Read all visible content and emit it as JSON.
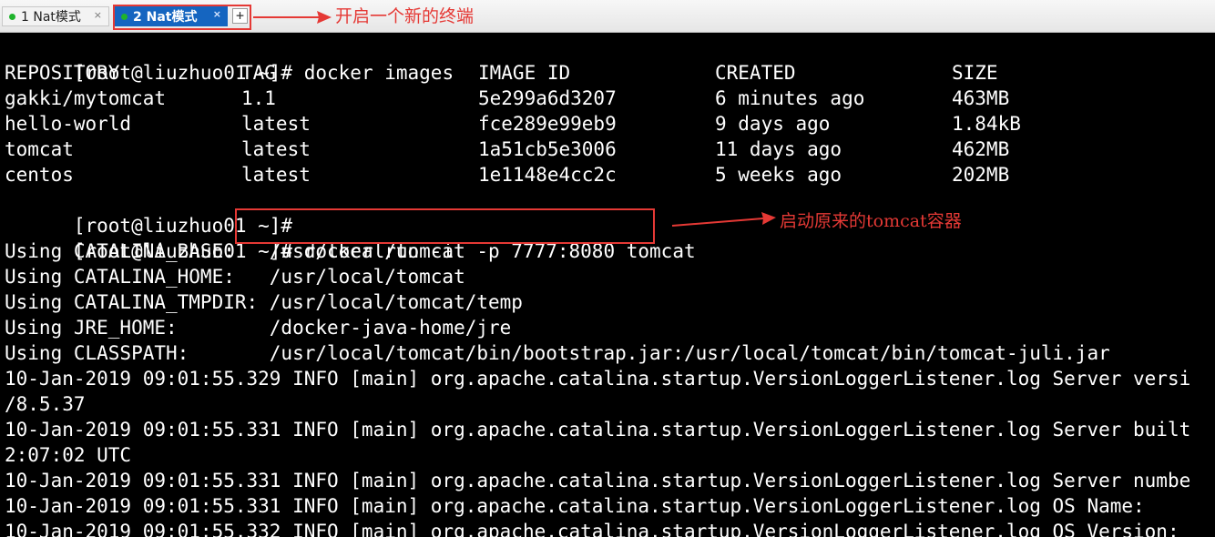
{
  "tabs": [
    {
      "label": "1 Nat模式",
      "close": "×",
      "active": false
    },
    {
      "label": "2 Nat模式",
      "close": "×",
      "active": true
    }
  ],
  "new_tab_label": "+",
  "annotations": {
    "new_terminal": "开启一个新的终端",
    "start_container": "启动原来的tomcat容器"
  },
  "colors": {
    "annotation_red": "#e53935",
    "active_tab": "#1565c0",
    "status_dot": "#1fb32b",
    "terminal_bg": "#000000",
    "terminal_fg": "#ffffff"
  },
  "terminal": {
    "prompt": "[root@liuzhuo01 ~]#",
    "cmd_images": "docker images",
    "images_table": {
      "headers": [
        "REPOSITORY",
        "TAG",
        "IMAGE ID",
        "CREATED",
        "SIZE"
      ],
      "rows": [
        [
          "gakki/mytomcat",
          "1.1",
          "5e299a6d3207",
          "6 minutes ago",
          "463MB"
        ],
        [
          "hello-world",
          "latest",
          "fce289e99eb9",
          "9 days ago",
          "1.84kB"
        ],
        [
          "tomcat",
          "latest",
          "1a51cb5e3006",
          "11 days ago",
          "462MB"
        ],
        [
          "centos",
          "latest",
          "1e1148e4cc2c",
          "5 weeks ago",
          "202MB"
        ]
      ]
    },
    "cmd_run": "docker run -it -p 7777:8080 tomcat",
    "env_lines": [
      "Using CATALINA_BASE:   /usr/local/tomcat",
      "Using CATALINA_HOME:   /usr/local/tomcat",
      "Using CATALINA_TMPDIR: /usr/local/tomcat/temp",
      "Using JRE_HOME:        /docker-java-home/jre",
      "Using CLASSPATH:       /usr/local/tomcat/bin/bootstrap.jar:/usr/local/tomcat/bin/tomcat-juli.jar"
    ],
    "log_lines": [
      "10-Jan-2019 09:01:55.329 INFO [main] org.apache.catalina.startup.VersionLoggerListener.log Server versi",
      "/8.5.37",
      "10-Jan-2019 09:01:55.331 INFO [main] org.apache.catalina.startup.VersionLoggerListener.log Server built",
      "2:07:02 UTC",
      "10-Jan-2019 09:01:55.331 INFO [main] org.apache.catalina.startup.VersionLoggerListener.log Server numbe",
      "10-Jan-2019 09:01:55.331 INFO [main] org.apache.catalina.startup.VersionLoggerListener.log OS Name:",
      "10-Jan-2019 09:01:55.332 INFO [main] org.apache.catalina.startup.VersionLoggerListener.log OS Version:"
    ]
  }
}
